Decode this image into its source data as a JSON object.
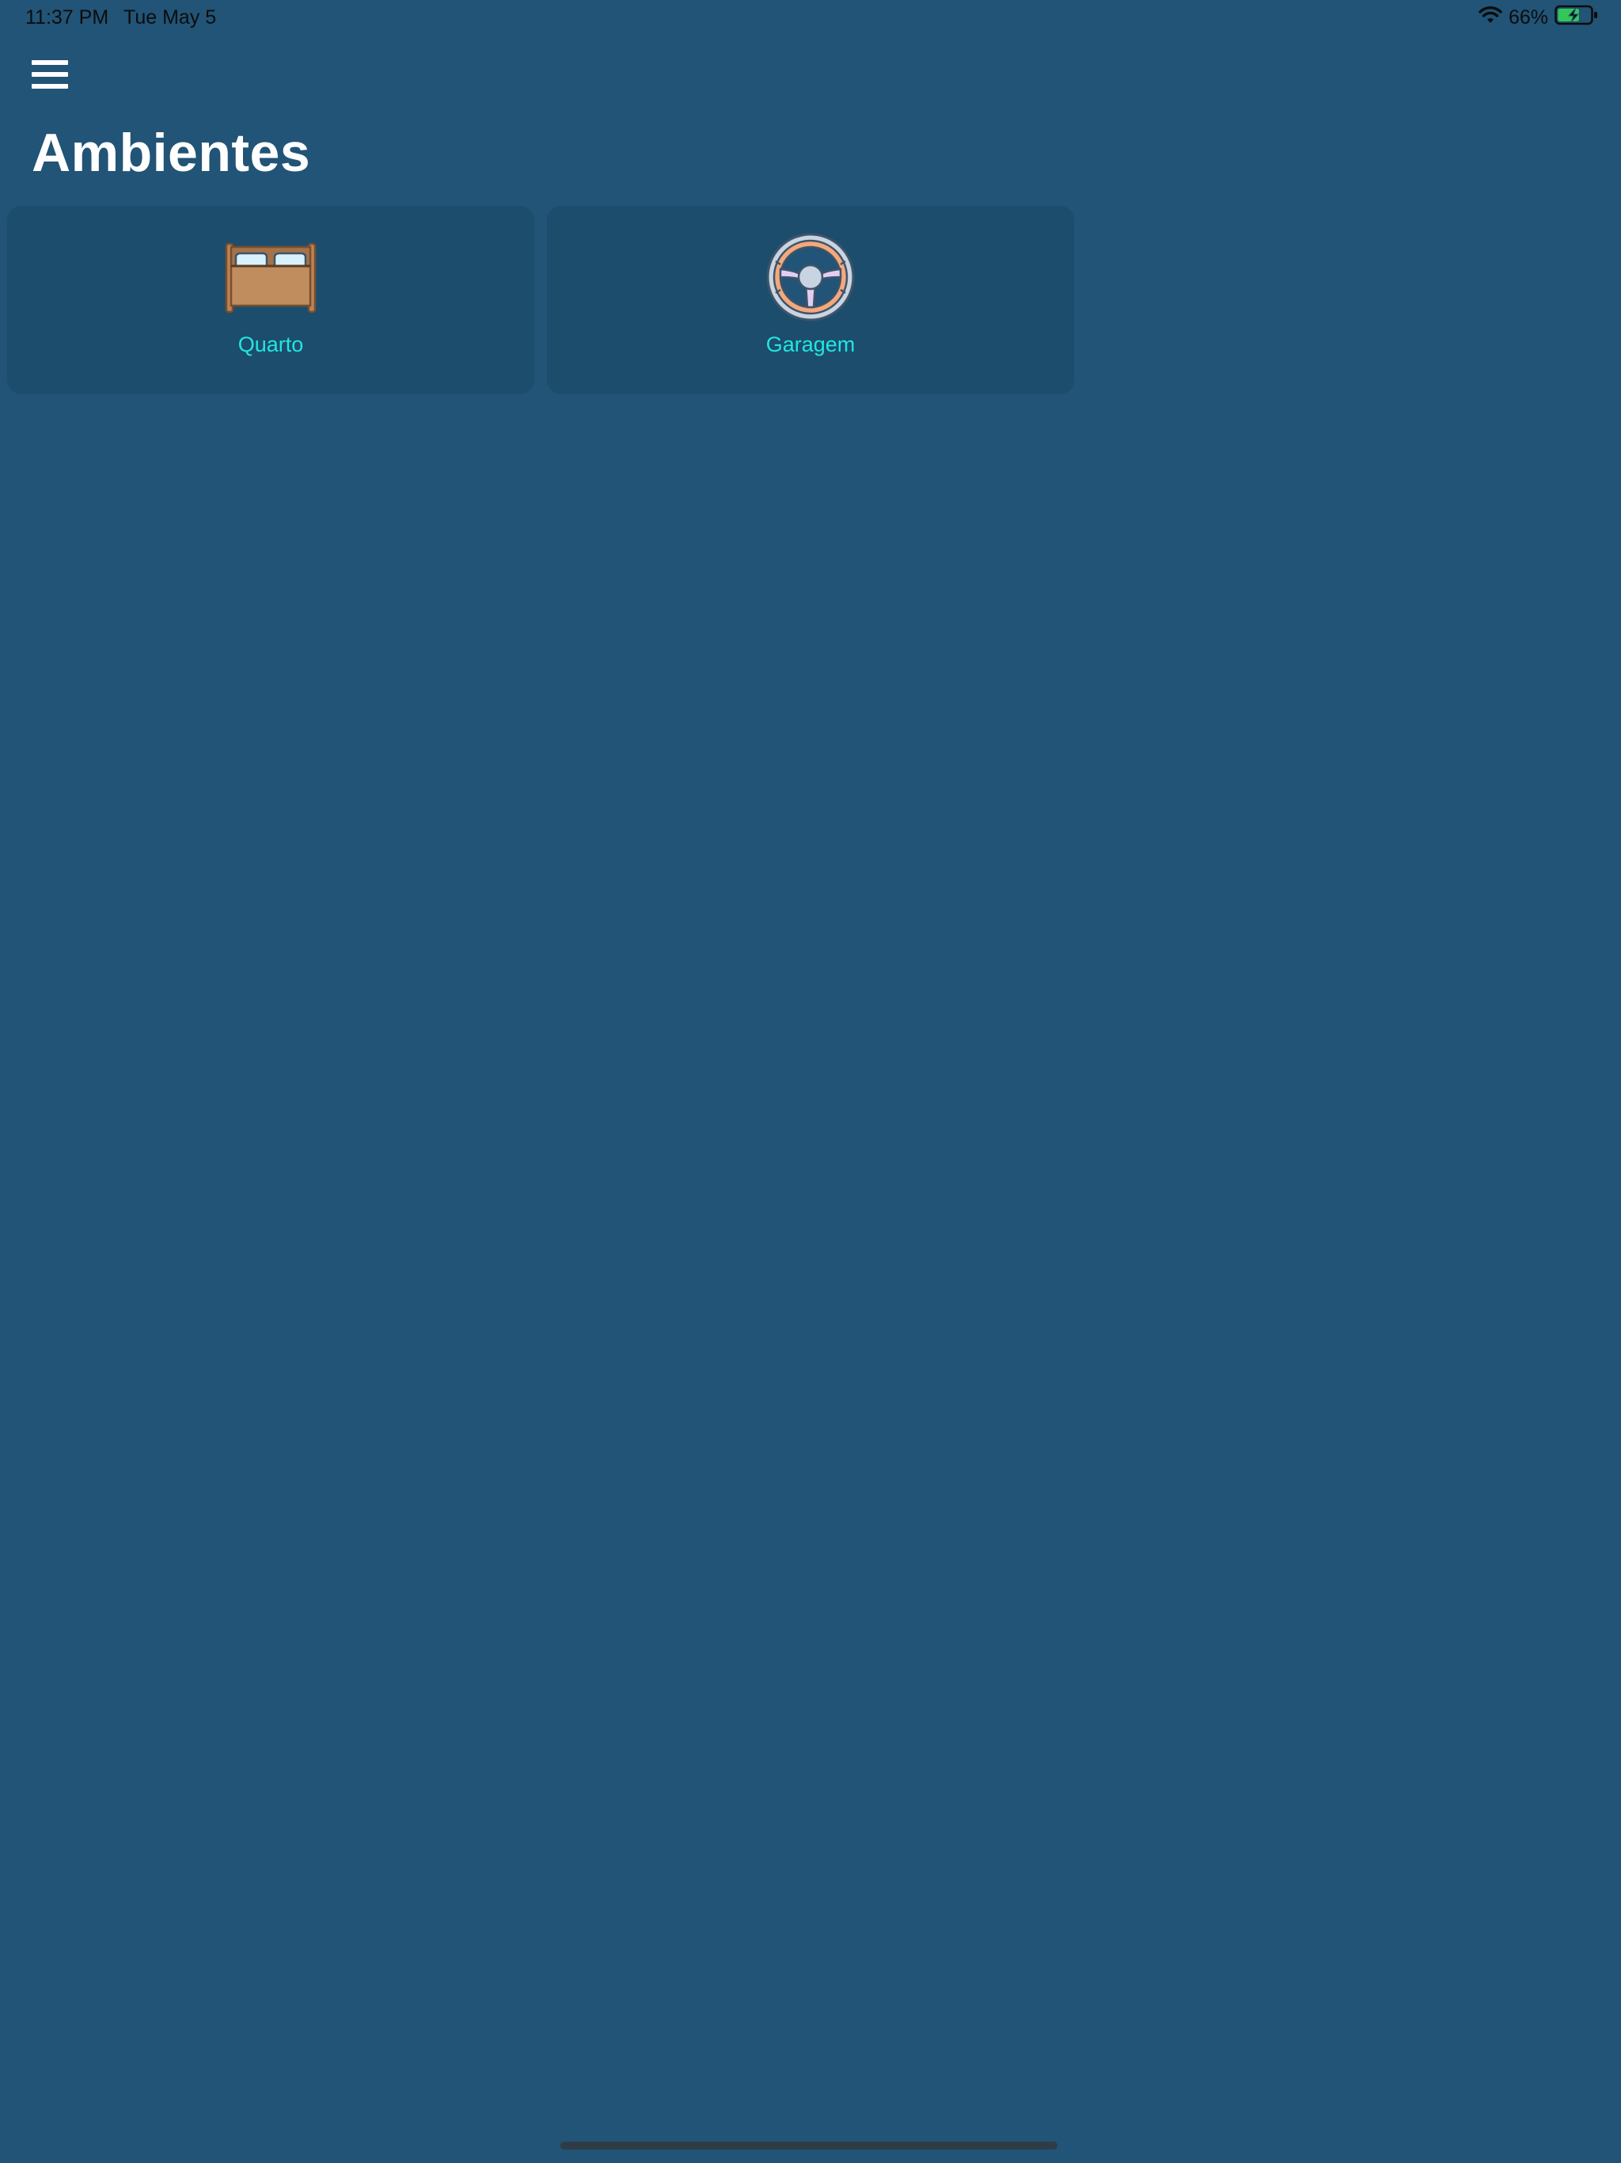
{
  "status_bar": {
    "time": "11:37 PM",
    "date": "Tue May 5",
    "battery_percent": "66%",
    "battery_level": 0.66,
    "icons": [
      "wifi-icon",
      "battery-charging-icon"
    ]
  },
  "header": {
    "menu_icon": "hamburger-menu-icon",
    "title": "Ambientes"
  },
  "rooms": [
    {
      "label": "Quarto",
      "icon": "bed-icon"
    },
    {
      "label": "Garagem",
      "icon": "steering-wheel-icon"
    }
  ],
  "colors": {
    "background": "#215476",
    "card": "#1c4d6d",
    "label": "#22e6e0",
    "title": "#ffffff"
  }
}
